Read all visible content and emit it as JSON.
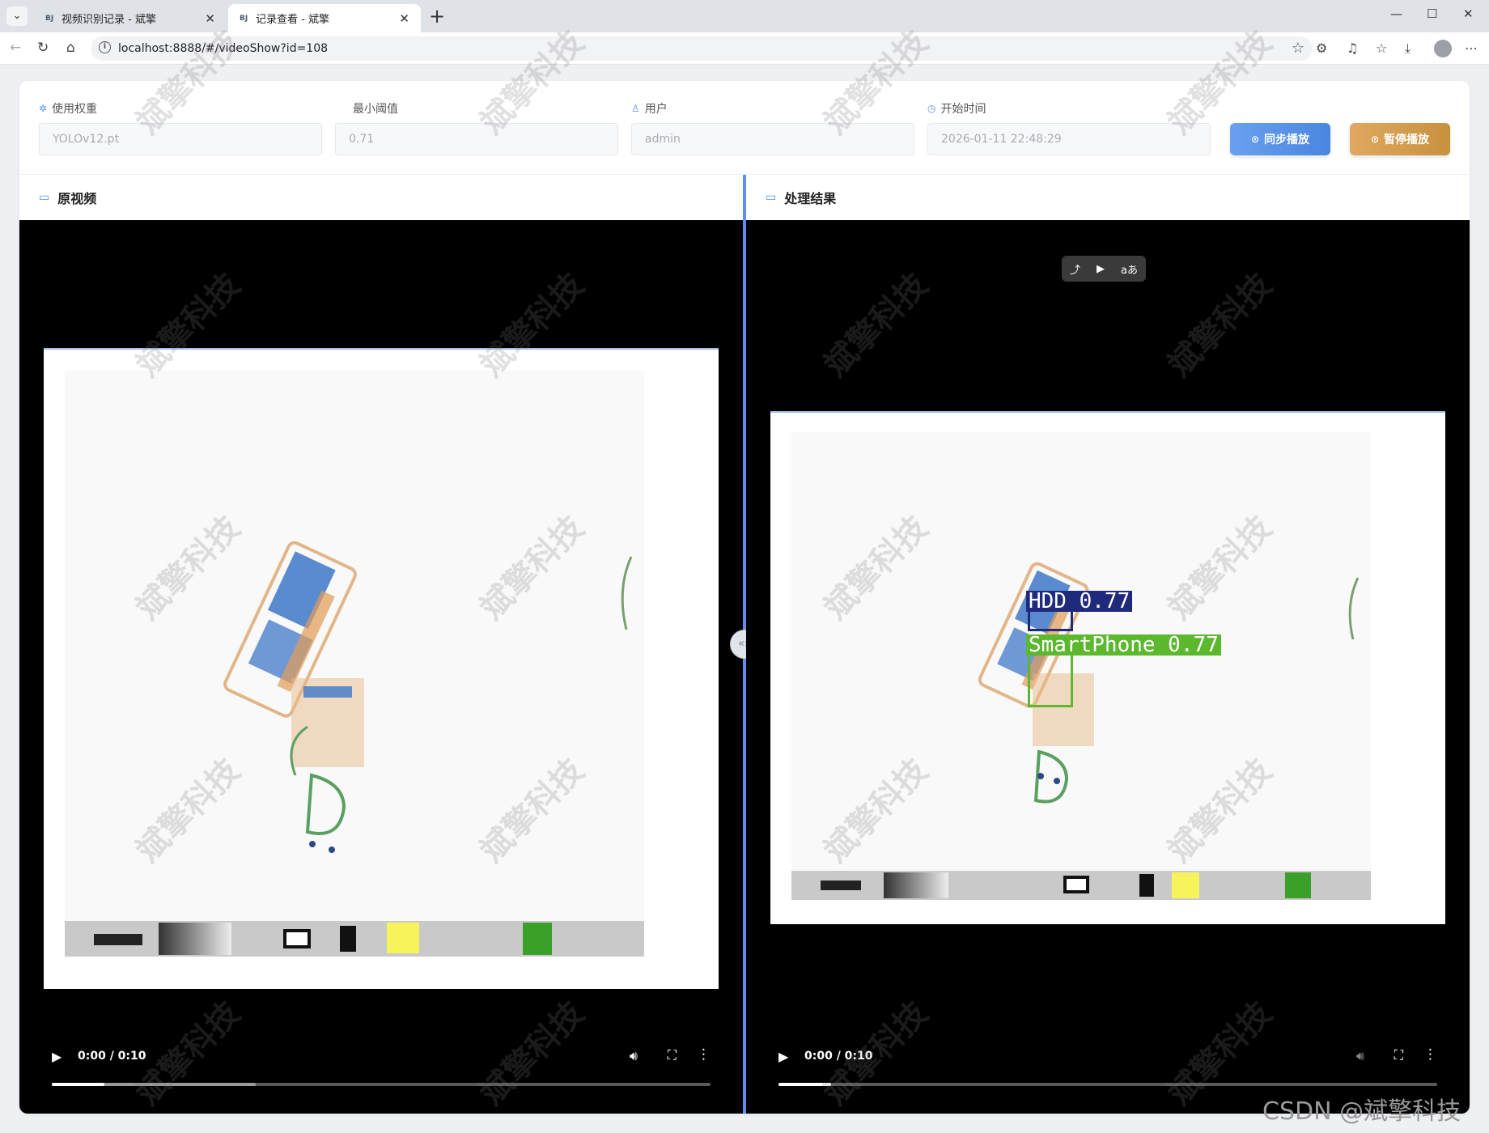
{
  "browser": {
    "tabs": [
      {
        "favicon": "BJ",
        "title": "视频识别记录 - 斌擎",
        "active": false
      },
      {
        "favicon": "BJ",
        "title": "记录查看 - 斌擎",
        "active": true
      }
    ],
    "url": "localhost:8888/#/videoShow?id=108"
  },
  "filters": {
    "weight": {
      "label": "使用权重",
      "value": "YOLOv12.pt",
      "icon": "cpu-icon"
    },
    "threshold": {
      "label": "最小阈值",
      "value": "0.71"
    },
    "user": {
      "label": "用户",
      "value": "admin",
      "icon": "user-icon"
    },
    "start_time": {
      "label": "开始时间",
      "value": "2026-01-11 22:48:29",
      "icon": "clock-icon"
    }
  },
  "actions": {
    "sync_label": "同步播放",
    "pause_label": "暂停播放"
  },
  "panels": {
    "original": {
      "title": "原视频",
      "time": "0:00 / 0:10",
      "progress": 0.08,
      "buffered": 0.31
    },
    "result": {
      "title": "处理结果",
      "time": "0:00 / 0:10",
      "progress": 0.08,
      "buffered": 0.08
    }
  },
  "detections": [
    {
      "label": "HDD 0.77",
      "color": "#1f2a7a"
    },
    {
      "label": "SmartPhone 0.77",
      "color": "#5cb82f"
    }
  ],
  "pip_buttons": [
    "⤴",
    "▶",
    "aあ"
  ],
  "watermark": "斌擎科技",
  "csdn": "CSDN @斌擎科技",
  "colors": {
    "accent": "#5b8ff0",
    "sync": "#4a86e0",
    "pause": "#c8913e"
  }
}
